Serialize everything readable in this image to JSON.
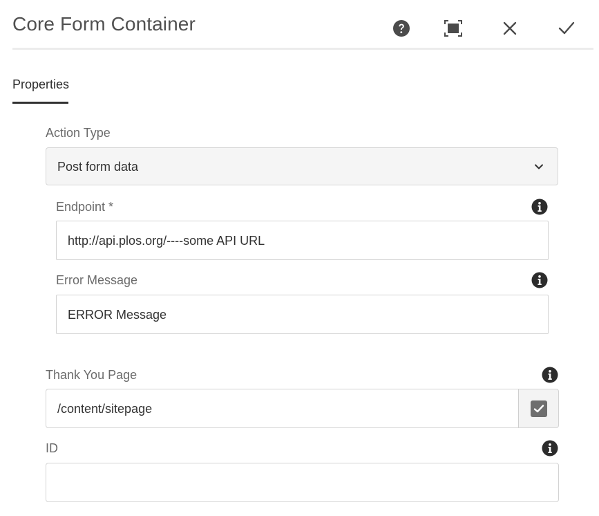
{
  "header": {
    "title": "Core Form Container",
    "buttons": {
      "help": "help-icon",
      "fullscreen": "fullscreen-icon",
      "close": "close-icon",
      "done": "check-icon"
    }
  },
  "tabs": [
    {
      "label": "Properties",
      "active": true
    }
  ],
  "form": {
    "action_type": {
      "label": "Action Type",
      "value": "Post form data"
    },
    "endpoint": {
      "label": "Endpoint *",
      "value": "http://api.plos.org/----some API URL"
    },
    "error_message": {
      "label": "Error Message",
      "value": "ERROR Message"
    },
    "thank_you_page": {
      "label": "Thank You Page",
      "value": "/content/sitepage"
    },
    "id": {
      "label": "ID",
      "value": ""
    }
  },
  "colors": {
    "icon": "#4b4b4b",
    "info_icon": "#2c2c2c",
    "select_bg": "#f5f5f5",
    "border": "#d3d3d3"
  }
}
